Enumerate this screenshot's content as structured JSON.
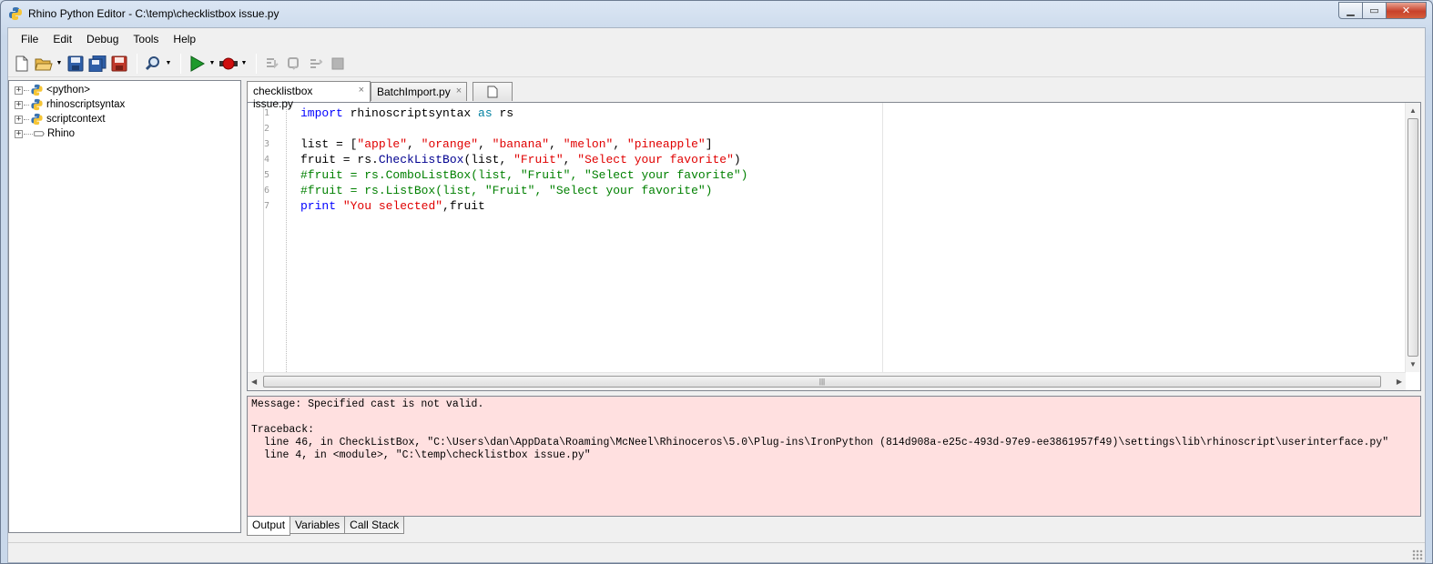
{
  "window": {
    "title": "Rhino Python Editor - C:\\temp\\checklistbox issue.py",
    "controls": [
      "minimize",
      "maximize",
      "close"
    ]
  },
  "menu": {
    "items": [
      "File",
      "Edit",
      "Debug",
      "Tools",
      "Help"
    ]
  },
  "toolbar": {
    "buttons": [
      "new-file-icon",
      "open-folder-icon",
      "save-icon",
      "save-all-icon",
      "save-as-icon",
      "find-icon",
      "run-icon",
      "breakpoint-icon",
      "step-into-icon",
      "step-over-icon",
      "step-out-icon",
      "stop-icon"
    ]
  },
  "tree": {
    "items": [
      {
        "label": "<python>",
        "icon": "python-icon",
        "expander": "+"
      },
      {
        "label": "rhinoscriptsyntax",
        "icon": "python-icon",
        "expander": "+"
      },
      {
        "label": "scriptcontext",
        "icon": "python-icon",
        "expander": "+"
      },
      {
        "label": "Rhino",
        "icon": "namespace-icon",
        "expander": "+"
      }
    ]
  },
  "tabs": [
    {
      "label": "checklistbox issue.py",
      "close": "×",
      "active": true
    },
    {
      "label": "BatchImport.py",
      "close": "×",
      "active": false
    }
  ],
  "editor": {
    "line_numbers": [
      "1",
      "2",
      "3",
      "4",
      "5",
      "6",
      "7"
    ],
    "lines": [
      {
        "tokens": [
          {
            "t": "kw",
            "v": "import"
          },
          {
            "t": "",
            "v": " rhinoscriptsyntax "
          },
          {
            "t": "kw2",
            "v": "as"
          },
          {
            "t": "",
            "v": " rs"
          }
        ]
      },
      {
        "tokens": []
      },
      {
        "tokens": [
          {
            "t": "",
            "v": "list = ["
          },
          {
            "t": "str",
            "v": "\"apple\""
          },
          {
            "t": "",
            "v": ", "
          },
          {
            "t": "str",
            "v": "\"orange\""
          },
          {
            "t": "",
            "v": ", "
          },
          {
            "t": "str",
            "v": "\"banana\""
          },
          {
            "t": "",
            "v": ", "
          },
          {
            "t": "str",
            "v": "\"melon\""
          },
          {
            "t": "",
            "v": ", "
          },
          {
            "t": "str",
            "v": "\"pineapple\""
          },
          {
            "t": "",
            "v": "]"
          }
        ]
      },
      {
        "tokens": [
          {
            "t": "",
            "v": "fruit = rs."
          },
          {
            "t": "fn",
            "v": "CheckListBox"
          },
          {
            "t": "",
            "v": "(list, "
          },
          {
            "t": "str",
            "v": "\"Fruit\""
          },
          {
            "t": "",
            "v": ", "
          },
          {
            "t": "str",
            "v": "\"Select your favorite\""
          },
          {
            "t": "",
            "v": ")"
          }
        ]
      },
      {
        "tokens": [
          {
            "t": "cm",
            "v": "#fruit = rs.ComboListBox(list, \"Fruit\", \"Select your favorite\")"
          }
        ]
      },
      {
        "tokens": [
          {
            "t": "cm",
            "v": "#fruit = rs.ListBox(list, \"Fruit\", \"Select your favorite\")"
          }
        ]
      },
      {
        "tokens": [
          {
            "t": "kw",
            "v": "print"
          },
          {
            "t": "",
            "v": " "
          },
          {
            "t": "str",
            "v": "\"You selected\""
          },
          {
            "t": "",
            "v": ",fruit"
          }
        ]
      }
    ]
  },
  "output": {
    "lines": [
      "Message: Specified cast is not valid.",
      "",
      "Traceback:",
      "  line 46, in CheckListBox, \"C:\\Users\\dan\\AppData\\Roaming\\McNeel\\Rhinoceros\\5.0\\Plug-ins\\IronPython (814d908a-e25c-493d-97e9-ee3861957f49)\\settings\\lib\\rhinoscript\\userinterface.py\"",
      "  line 4, in <module>, \"C:\\temp\\checklistbox issue.py\""
    ],
    "background": "#ffe0e0"
  },
  "bottom_tabs": [
    {
      "label": "Output",
      "active": true
    },
    {
      "label": "Variables",
      "active": false
    },
    {
      "label": "Call Stack",
      "active": false
    }
  ]
}
